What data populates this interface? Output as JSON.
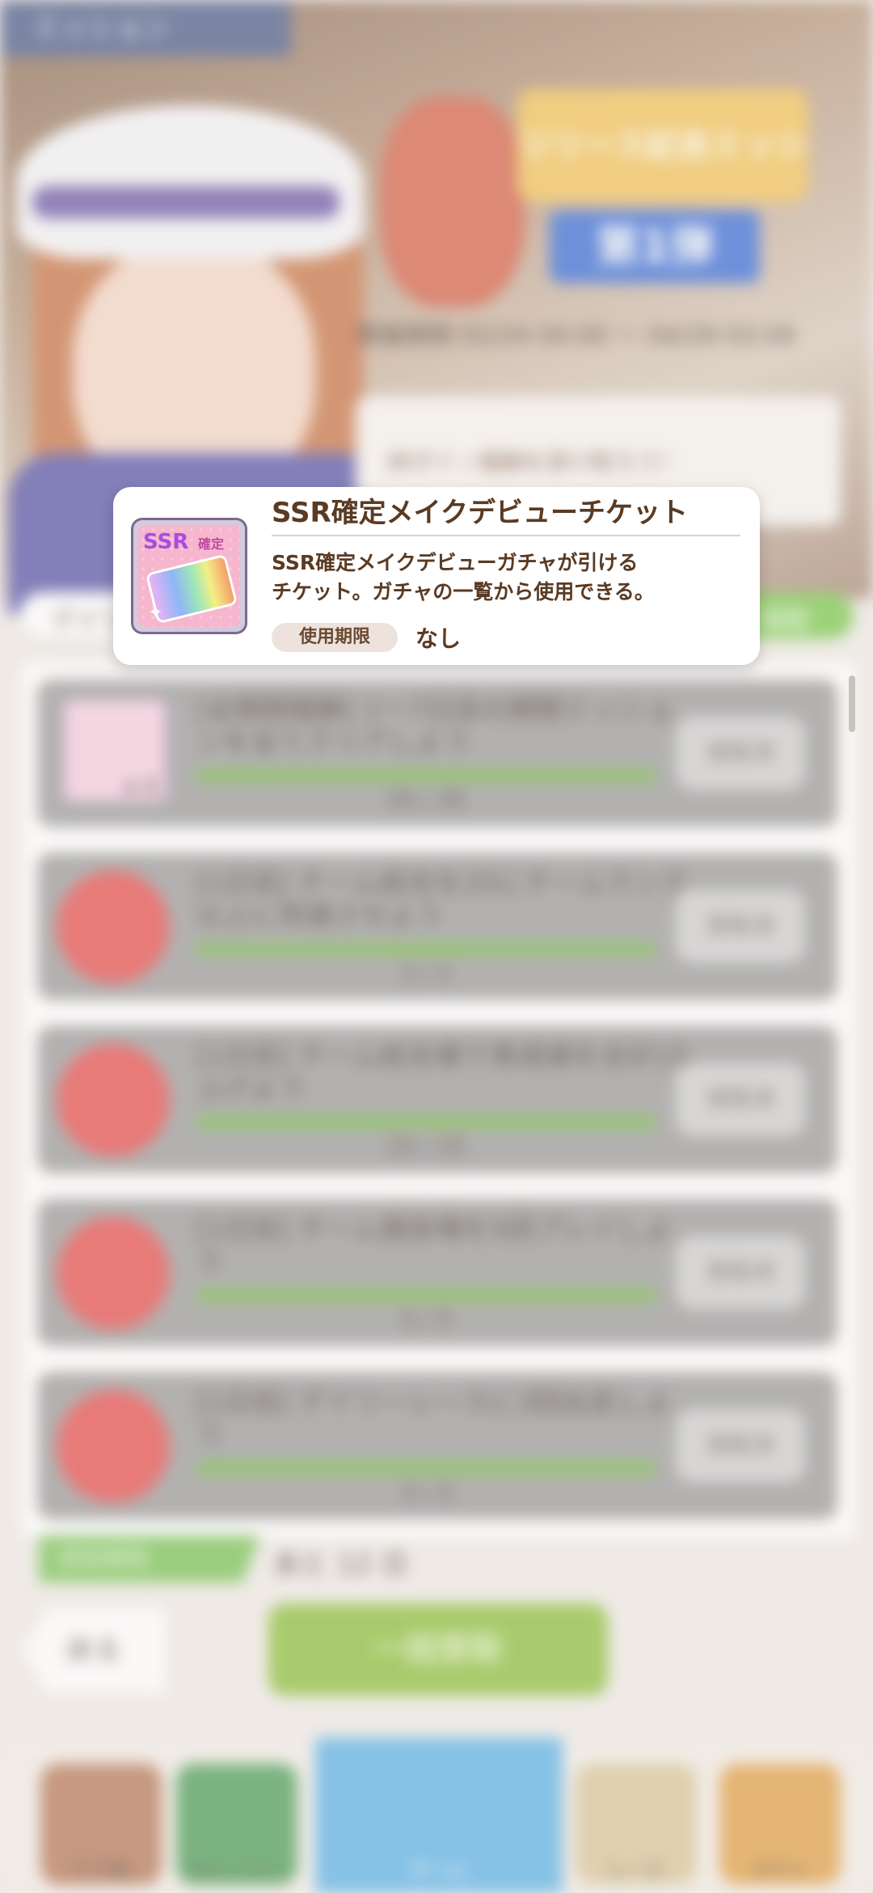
{
  "screen": {
    "header_tab": "ミッション",
    "banner": {
      "title": "リリース記念ミッション",
      "badge": "第1弾",
      "period": "開催期間 02/24 04:00 ～ 04/29 03:59",
      "promo": "絆ポイ / 報酬を受け取ろう！"
    },
    "tabs": {
      "left": "デイリー",
      "right": "期間"
    },
    "missions": [
      {
        "text": "[全期間報酬] 1～7日目の期間ミッションを全てクリアしよう",
        "count": "35 / 35",
        "progress": 1.0,
        "button": "受取済",
        "reward": "SSR確定メイクデビューチケット",
        "reward_qty": "x 1"
      },
      {
        "text": "[1日目] チーム総合を25にチームランク以上に到達させよう",
        "count": "1 / 1",
        "progress": 1.0,
        "button": "受取済",
        "reward": "ジュエル"
      },
      {
        "text": "[1日目] チーム総合値で育成値を合計15上げよう",
        "count": "15 / 15",
        "progress": 1.0,
        "button": "受取済",
        "reward": "ジュエル"
      },
      {
        "text": "[1日目] チーム競技場を5回プレイしよう",
        "count": "5 / 5",
        "progress": 1.0,
        "button": "受取済",
        "reward": "ジュエル"
      },
      {
        "text": "[1日目] デイリーレースに3回出走しよう",
        "count": "3 / 3",
        "progress": 1.0,
        "button": "受取済",
        "reward": "ジュエル"
      }
    ],
    "expiry": {
      "label": "受取期限",
      "value": "あと 12 日"
    },
    "back_button": "戻る",
    "receive_all_button": "一括受取",
    "nav": [
      {
        "label": "ウマ娘"
      },
      {
        "label": "ストーリー"
      },
      {
        "label": "ホーム"
      },
      {
        "label": "レース"
      },
      {
        "label": "ガチャ"
      }
    ]
  },
  "popup": {
    "title": "SSR確定メイクデビューチケット",
    "icon_label": "SSR",
    "icon_sub": "確定",
    "description_line1": "SSR確定メイクデビューガチャが引ける",
    "description_line2": "チケット。ガチャの一覧から使用できる。",
    "expiry_tag": "使用期限",
    "expiry_value": "なし"
  }
}
